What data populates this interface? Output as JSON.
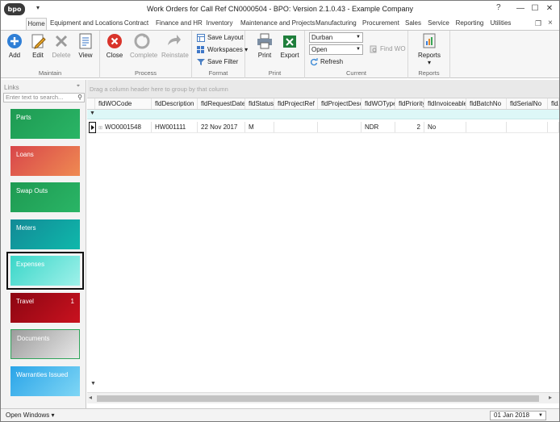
{
  "window": {
    "logo": "bpo",
    "title": "Work Orders for Call Ref CN0000504 - BPO: Version 2.1.0.43 - Example Company",
    "help": "?",
    "minimize": "—",
    "maximize": "☐",
    "close": "✕"
  },
  "tabs": [
    "Home",
    "Equipment and Locations",
    "Contract",
    "Finance and HR",
    "Inventory",
    "Maintenance and Projects",
    "Manufacturing",
    "Procurement",
    "Sales",
    "Service",
    "Reporting",
    "Utilities"
  ],
  "ribbon": {
    "maintain": {
      "label": "Maintain",
      "add": "Add",
      "edit": "Edit",
      "delete": "Delete",
      "view": "View"
    },
    "process": {
      "label": "Process",
      "close": "Close",
      "complete": "Complete",
      "reinstate": "Reinstate"
    },
    "format": {
      "label": "Format",
      "save_layout": "Save Layout",
      "workspaces": "Workspaces",
      "save_filter": "Save Filter"
    },
    "print": {
      "label": "Print",
      "print": "Print",
      "export": "Export"
    },
    "current": {
      "label": "Current",
      "site": "Durban",
      "status": "Open",
      "refresh": "Refresh",
      "find_wo": "Find WO"
    },
    "reports": {
      "label": "Reports",
      "reports": "Reports"
    }
  },
  "links": {
    "header": "Links",
    "search_placeholder": "Enter text to search...",
    "tiles": [
      {
        "label": "Parts",
        "badge": ""
      },
      {
        "label": "Loans",
        "badge": ""
      },
      {
        "label": "Swap Outs",
        "badge": ""
      },
      {
        "label": "Meters",
        "badge": ""
      },
      {
        "label": "Expenses",
        "badge": ""
      },
      {
        "label": "Travel",
        "badge": "1"
      },
      {
        "label": "Documents",
        "badge": ""
      },
      {
        "label": "Warranties Issued",
        "badge": ""
      }
    ]
  },
  "grid": {
    "group_hint": "Drag a column header here to group by that column",
    "columns": [
      "fldWOCode",
      "fldDescription",
      "fldRequestDate",
      "fldStatus",
      "fldProjectRef",
      "fldProjectDesc",
      "fldWOType",
      "fldPriority",
      "fldInvoiceable",
      "fldBatchNo",
      "fldSerialNo",
      "fldA"
    ],
    "rows": [
      [
        "WO0001548",
        "HW001111",
        "22 Nov 2017",
        "M",
        "",
        "",
        "NDR",
        "2",
        "No",
        "",
        "",
        ""
      ]
    ]
  },
  "status": {
    "open_windows": "Open Windows",
    "date": "01 Jan 2018"
  },
  "colors": {
    "tile_parts": "#22a35a",
    "tile_loans": "#e0604a",
    "tile_swapouts": "#22a35a",
    "tile_meters": "#0fa8a0",
    "tile_expenses": "#52e0d2",
    "tile_travel": "#a00d18",
    "tile_documents": "#b7b7b7",
    "tile_warranties": "#3cb2ec"
  }
}
